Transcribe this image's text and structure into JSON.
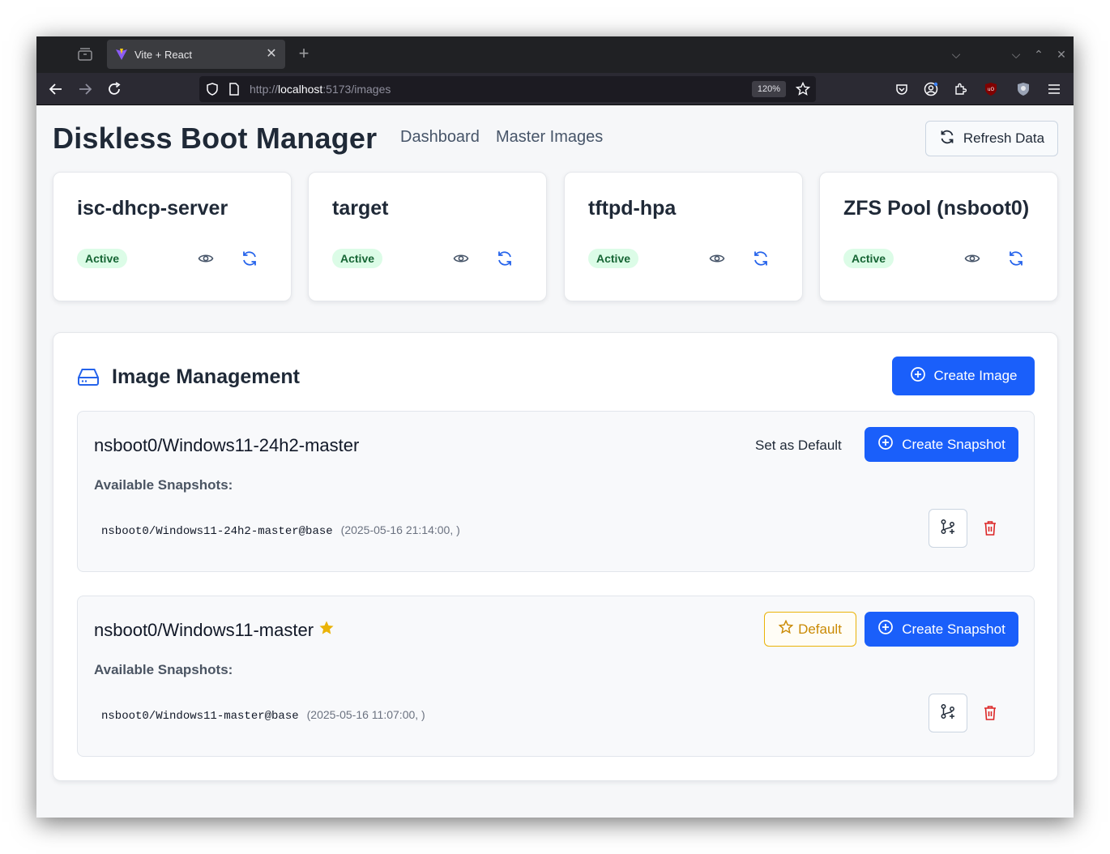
{
  "browser": {
    "tab_title": "Vite + React",
    "url_prefix": "http://",
    "url_host": "localhost",
    "url_path": ":5173/images",
    "zoom": "120%"
  },
  "header": {
    "title": "Diskless Boot Manager",
    "nav": [
      "Dashboard",
      "Master Images"
    ],
    "refresh_label": "Refresh Data"
  },
  "services": [
    {
      "name": "isc-dhcp-server",
      "status": "Active"
    },
    {
      "name": "target",
      "status": "Active"
    },
    {
      "name": "tftpd-hpa",
      "status": "Active"
    },
    {
      "name": "ZFS Pool (nsboot0)",
      "status": "Active"
    }
  ],
  "management": {
    "title": "Image Management",
    "create_image_label": "Create Image",
    "images": [
      {
        "name": "nsboot0/Windows11-24h2-master",
        "is_default": false,
        "set_default_label": "Set as Default",
        "create_snapshot_label": "Create Snapshot",
        "snapshots_label": "Available Snapshots:",
        "snapshots": [
          {
            "name": "nsboot0/Windows11-24h2-master@base",
            "meta": "(2025-05-16 21:14:00, )"
          }
        ]
      },
      {
        "name": "nsboot0/Windows11-master",
        "is_default": true,
        "default_label": "Default",
        "create_snapshot_label": "Create Snapshot",
        "snapshots_label": "Available Snapshots:",
        "snapshots": [
          {
            "name": "nsboot0/Windows11-master@base",
            "meta": "(2025-05-16 11:07:00, )"
          }
        ]
      }
    ]
  },
  "colors": {
    "primary": "#1a5ffa",
    "active_badge_bg": "#dcfce7",
    "active_badge_text": "#166534",
    "default_accent": "#eab308",
    "danger": "#dc2626"
  }
}
